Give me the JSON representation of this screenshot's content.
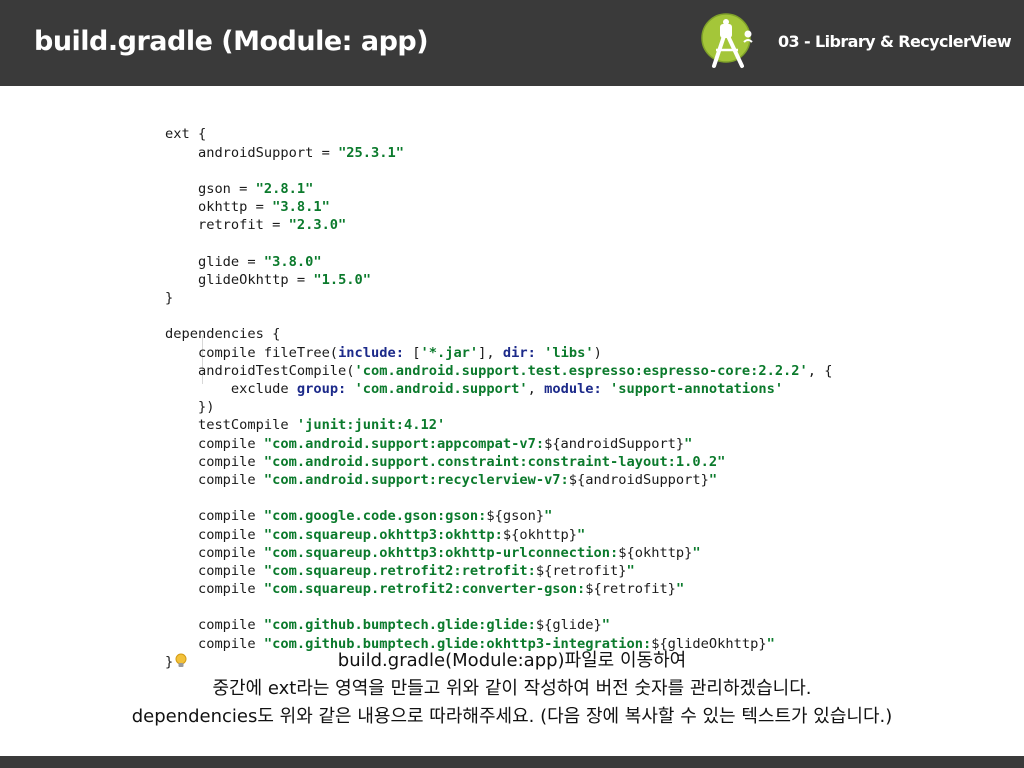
{
  "header": {
    "title": "build.gradle (Module: app)",
    "subtitle": "03 - Library & RecyclerView",
    "logo_icon": "android-studio-icon"
  },
  "code_lines": [
    [
      {
        "t": "ext {",
        "c": ""
      }
    ],
    [
      {
        "t": "    androidSupport = ",
        "c": ""
      },
      {
        "t": "\"25.3.1\"",
        "c": "str"
      }
    ],
    [],
    [
      {
        "t": "    gson = ",
        "c": ""
      },
      {
        "t": "\"2.8.1\"",
        "c": "str"
      }
    ],
    [
      {
        "t": "    okhttp = ",
        "c": ""
      },
      {
        "t": "\"3.8.1\"",
        "c": "str"
      }
    ],
    [
      {
        "t": "    retrofit = ",
        "c": ""
      },
      {
        "t": "\"2.3.0\"",
        "c": "str"
      }
    ],
    [],
    [
      {
        "t": "    glide = ",
        "c": ""
      },
      {
        "t": "\"3.8.0\"",
        "c": "str"
      }
    ],
    [
      {
        "t": "    glideOkhttp = ",
        "c": ""
      },
      {
        "t": "\"1.5.0\"",
        "c": "str"
      }
    ],
    [
      {
        "t": "}",
        "c": ""
      }
    ],
    [],
    [
      {
        "t": "dependencies {",
        "c": ""
      }
    ],
    [
      {
        "t": "    compile fileTree(",
        "c": ""
      },
      {
        "t": "include:",
        "c": "kw"
      },
      {
        "t": " [",
        "c": ""
      },
      {
        "t": "'*.jar'",
        "c": "str"
      },
      {
        "t": "], ",
        "c": ""
      },
      {
        "t": "dir:",
        "c": "kw"
      },
      {
        "t": " ",
        "c": ""
      },
      {
        "t": "'libs'",
        "c": "str"
      },
      {
        "t": ")",
        "c": ""
      }
    ],
    [
      {
        "t": "    androidTestCompile(",
        "c": ""
      },
      {
        "t": "'com.android.support.test.espresso:espresso-core:2.2.2'",
        "c": "str"
      },
      {
        "t": ", {",
        "c": ""
      }
    ],
    [
      {
        "t": "        exclude ",
        "c": ""
      },
      {
        "t": "group:",
        "c": "kw"
      },
      {
        "t": " ",
        "c": ""
      },
      {
        "t": "'com.android.support'",
        "c": "str"
      },
      {
        "t": ", ",
        "c": ""
      },
      {
        "t": "module:",
        "c": "kw"
      },
      {
        "t": " ",
        "c": ""
      },
      {
        "t": "'support-annotations'",
        "c": "str"
      }
    ],
    [
      {
        "t": "    })",
        "c": ""
      }
    ],
    [
      {
        "t": "    testCompile ",
        "c": ""
      },
      {
        "t": "'junit:junit:4.12'",
        "c": "str"
      }
    ],
    [
      {
        "t": "    compile ",
        "c": ""
      },
      {
        "t": "\"com.android.support:appcompat-v7:",
        "c": "str"
      },
      {
        "t": "${androidSupport}",
        "c": ""
      },
      {
        "t": "\"",
        "c": "str"
      }
    ],
    [
      {
        "t": "    compile ",
        "c": ""
      },
      {
        "t": "\"com.android.support.constraint:constraint-layout:1.0.2\"",
        "c": "str"
      }
    ],
    [
      {
        "t": "    compile ",
        "c": ""
      },
      {
        "t": "\"com.android.support:recyclerview-v7:",
        "c": "str"
      },
      {
        "t": "${androidSupport}",
        "c": ""
      },
      {
        "t": "\"",
        "c": "str"
      }
    ],
    [],
    [
      {
        "t": "    compile ",
        "c": ""
      },
      {
        "t": "\"com.google.code.gson:gson:",
        "c": "str"
      },
      {
        "t": "${gson}",
        "c": ""
      },
      {
        "t": "\"",
        "c": "str"
      }
    ],
    [
      {
        "t": "    compile ",
        "c": ""
      },
      {
        "t": "\"com.squareup.okhttp3:okhttp:",
        "c": "str"
      },
      {
        "t": "${okhttp}",
        "c": ""
      },
      {
        "t": "\"",
        "c": "str"
      }
    ],
    [
      {
        "t": "    compile ",
        "c": ""
      },
      {
        "t": "\"com.squareup.okhttp3:okhttp-urlconnection:",
        "c": "str"
      },
      {
        "t": "${okhttp}",
        "c": ""
      },
      {
        "t": "\"",
        "c": "str"
      }
    ],
    [
      {
        "t": "    compile ",
        "c": ""
      },
      {
        "t": "\"com.squareup.retrofit2:retrofit:",
        "c": "str"
      },
      {
        "t": "${retrofit}",
        "c": ""
      },
      {
        "t": "\"",
        "c": "str"
      }
    ],
    [
      {
        "t": "    compile ",
        "c": ""
      },
      {
        "t": "\"com.squareup.retrofit2:converter-gson:",
        "c": "str"
      },
      {
        "t": "${retrofit}",
        "c": ""
      },
      {
        "t": "\"",
        "c": "str"
      }
    ],
    [],
    [
      {
        "t": "    compile ",
        "c": ""
      },
      {
        "t": "\"com.github.bumptech.glide:glide:",
        "c": "str"
      },
      {
        "t": "${glide}",
        "c": ""
      },
      {
        "t": "\"",
        "c": "str"
      }
    ],
    [
      {
        "t": "    compile ",
        "c": ""
      },
      {
        "t": "\"com.github.bumptech.glide:okhttp3-integration:",
        "c": "str"
      },
      {
        "t": "${glideOkhttp}",
        "c": ""
      },
      {
        "t": "\"",
        "c": "str"
      }
    ],
    [
      {
        "t": "}",
        "c": ""
      }
    ]
  ],
  "lightbulb_icon": "lightbulb-icon",
  "caption": {
    "line1": "build.gradle(Module:app)파일로 이동하여",
    "line2": "중간에 ext라는 영역을 만들고 위와 같이 작성하여 버전 숫자를 관리하겠습니다.",
    "line3": "dependencies도 위와 같은 내용으로 따라해주세요. (다음 장에 복사할 수 있는 텍스트가 있습니다.)"
  },
  "colors": {
    "header_bg": "#3a3a3a",
    "string": "#0b7a2c",
    "keyword": "#1c2a8a",
    "logo_green": "#a4c639"
  }
}
